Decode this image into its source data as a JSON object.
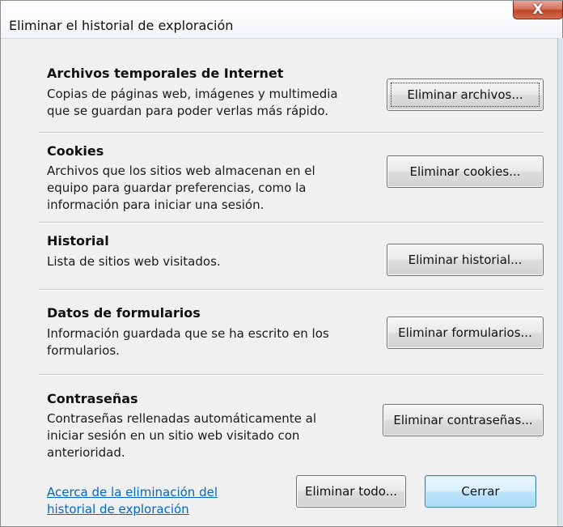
{
  "window": {
    "title": "Eliminar el historial de exploración",
    "close_label": "X"
  },
  "sections": [
    {
      "title": "Archivos temporales de Internet",
      "description": "Copias de páginas web, imágenes y multimedia\nque se guardan para poder verlas más rápido.",
      "button_label": "Eliminar archivos..."
    },
    {
      "title": "Cookies",
      "description": "Archivos que los sitios web almacenan en el\nequipo para guardar preferencias, como la\ninformación para iniciar una sesión.",
      "button_label": "Eliminar cookies..."
    },
    {
      "title": "Historial",
      "description": "Lista de sitios web visitados.",
      "button_label": "Eliminar historial..."
    },
    {
      "title": "Datos de formularios",
      "description": "Información guardada que se ha escrito en los\nformularios.",
      "button_label": "Eliminar formularios..."
    },
    {
      "title": "Contraseñas",
      "description": "Contraseñas rellenadas automáticamente al\niniciar sesión en un sitio web visitado con\nanterioridad.",
      "button_label": "Eliminar contraseñas..."
    }
  ],
  "footer": {
    "help_link": "Acerca de la eliminación del\nhistorial de exploración",
    "delete_all_label": "Eliminar todo...",
    "close_label": "Cerrar"
  }
}
